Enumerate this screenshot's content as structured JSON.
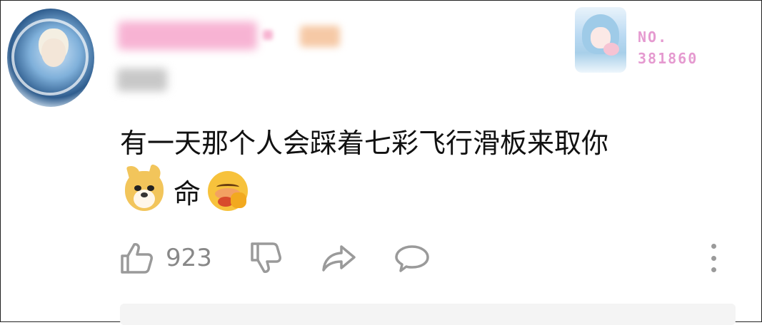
{
  "comment": {
    "avatar_icon": "anime-avatar-icon",
    "badge": {
      "prefix": "NO.",
      "number": "381860"
    },
    "text": "有一天那个人会踩着七彩飞行滑板来取你",
    "text_line2": "命",
    "emojis": [
      "doge-emoji",
      "shy-emoji"
    ]
  },
  "actions": {
    "like_count": "923",
    "icons": [
      "thumbs-up-icon",
      "thumbs-down-icon",
      "share-icon",
      "comment-icon",
      "more-vertical-icon"
    ]
  },
  "colors": {
    "badge": "#e59ad0",
    "icon_gray": "#9a9a9a",
    "reply_bg": "#f4f4f4"
  }
}
